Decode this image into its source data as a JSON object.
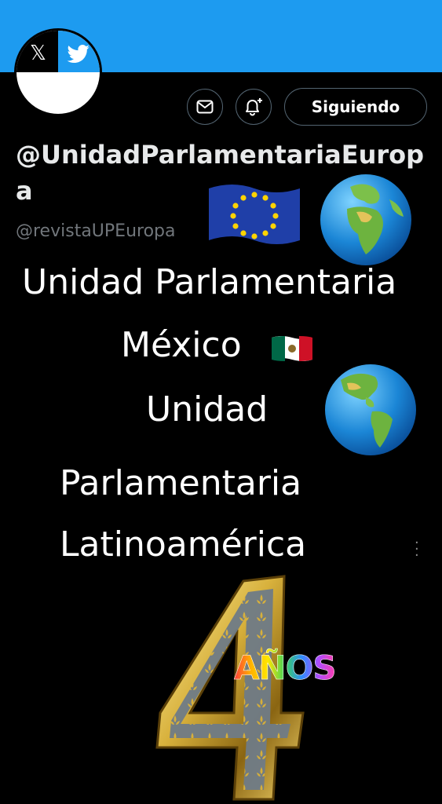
{
  "profile": {
    "display_name": "@UnidadParlamentariaEuropa",
    "handle": "@revistaUPEuropa",
    "follow_label": "Siguiendo",
    "avatar_x_glyph": "𝕏"
  },
  "icons": {
    "message": "envelope-icon",
    "notify": "bell-plus-icon",
    "eu_flag": "european-union-flag-icon",
    "globe_africa": "globe-europe-africa-icon",
    "globe_americas": "globe-americas-icon",
    "mexico_flag": "mexico-flag-icon"
  },
  "overlay": {
    "line1": "Unidad Parlamentaria",
    "line2": "México",
    "line3": "Unidad",
    "line4": "Parlamentaria",
    "line5": "Latinoamérica",
    "badge_number": "4",
    "badge_word": "AÑOS"
  },
  "colors": {
    "banner": "#1d9bf0",
    "background": "#000000",
    "handle_gray": "#71767b",
    "gold": "#d8b13c"
  }
}
